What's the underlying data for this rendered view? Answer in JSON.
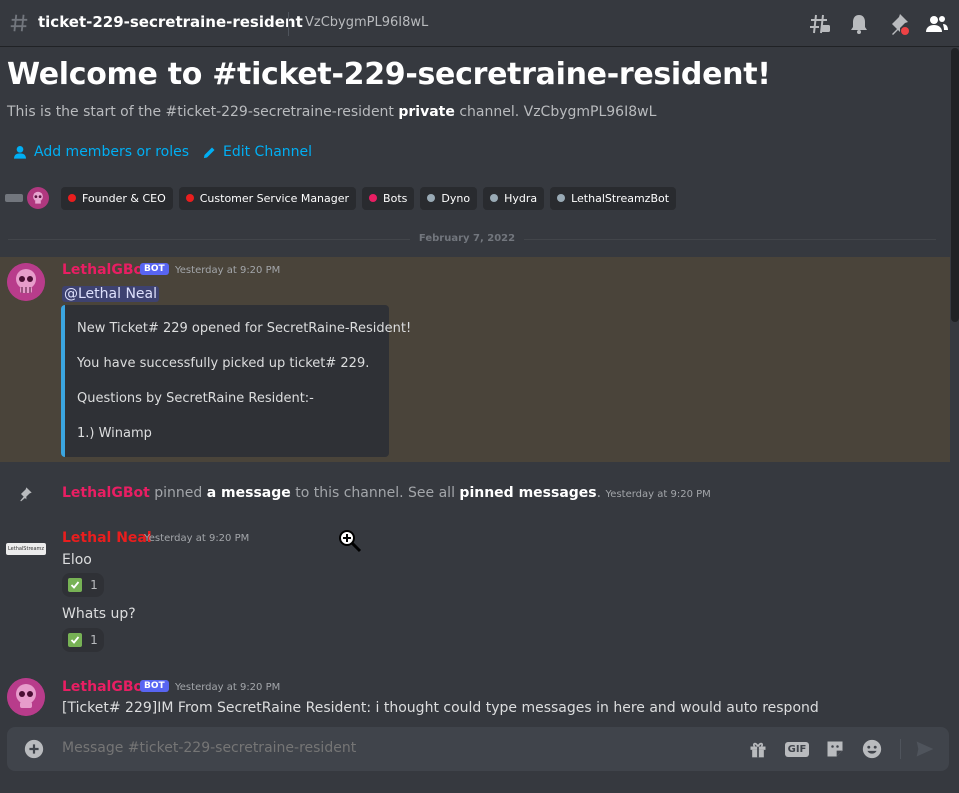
{
  "header": {
    "channel_name": "ticket-229-secretraine-resident",
    "topic": "VzCbygmPL96I8wL"
  },
  "welcome": {
    "title": "Welcome to #ticket-229-secretraine-resident!",
    "subtitle_pre": "This is the start of the #ticket-229-secretraine-resident",
    "subtitle_bold": "private",
    "subtitle_post": "channel. VzCbygmPL96I8wL",
    "add_members_label": "Add members or roles",
    "edit_channel_label": "Edit Channel"
  },
  "roles": [
    {
      "label": "Founder & CEO",
      "color": "#e91e1e"
    },
    {
      "label": "Customer Service Manager",
      "color": "#e91e1e"
    },
    {
      "label": "Bots",
      "color": "#e91e63"
    },
    {
      "label": "Dyno",
      "color": "#99aab5"
    },
    {
      "label": "Hydra",
      "color": "#99aab5"
    },
    {
      "label": "LethalStreamzBot",
      "color": "#99aab5"
    }
  ],
  "date_divider": "February 7, 2022",
  "messages": {
    "m1": {
      "author": "LethalGBot",
      "bot_tag": "BOT",
      "timestamp": "Yesterday at 9:20 PM",
      "mention": "@Lethal Neal",
      "embed": [
        "New Ticket# 229 opened for SecretRaine-Resident!",
        "You have successfully picked up ticket# 229.",
        "Questions by SecretRaine Resident:-",
        "1.) Winamp"
      ]
    },
    "pin": {
      "author": "LethalGBot",
      "text1": "pinned",
      "link1": "a message",
      "text2": "to this channel. See all",
      "link2": "pinned messages",
      "text3": ".",
      "timestamp": "Yesterday at 9:20 PM"
    },
    "m2": {
      "author": "Lethal Neal",
      "avatar_text": "LethalStreamz",
      "timestamp": "Yesterday at 9:20 PM",
      "line1": "Eloo",
      "reaction1_count": "1",
      "line2": "Whats up?",
      "reaction2_count": "1"
    },
    "m3": {
      "author": "LethalGBot",
      "bot_tag": "BOT",
      "timestamp": "Yesterday at 9:20 PM",
      "text": "[Ticket# 229]IM From SecretRaine Resident: i thought could type messages in here and would auto respond"
    }
  },
  "composer": {
    "placeholder": "Message #ticket-229-secretraine-resident",
    "gif_label": "GIF"
  },
  "colors": {
    "bot_author": "#e91e63",
    "user_author": "#e91e1e",
    "link": "#00aff4",
    "embed_border": "#3ba5e0",
    "highlight": "#4a443a"
  }
}
